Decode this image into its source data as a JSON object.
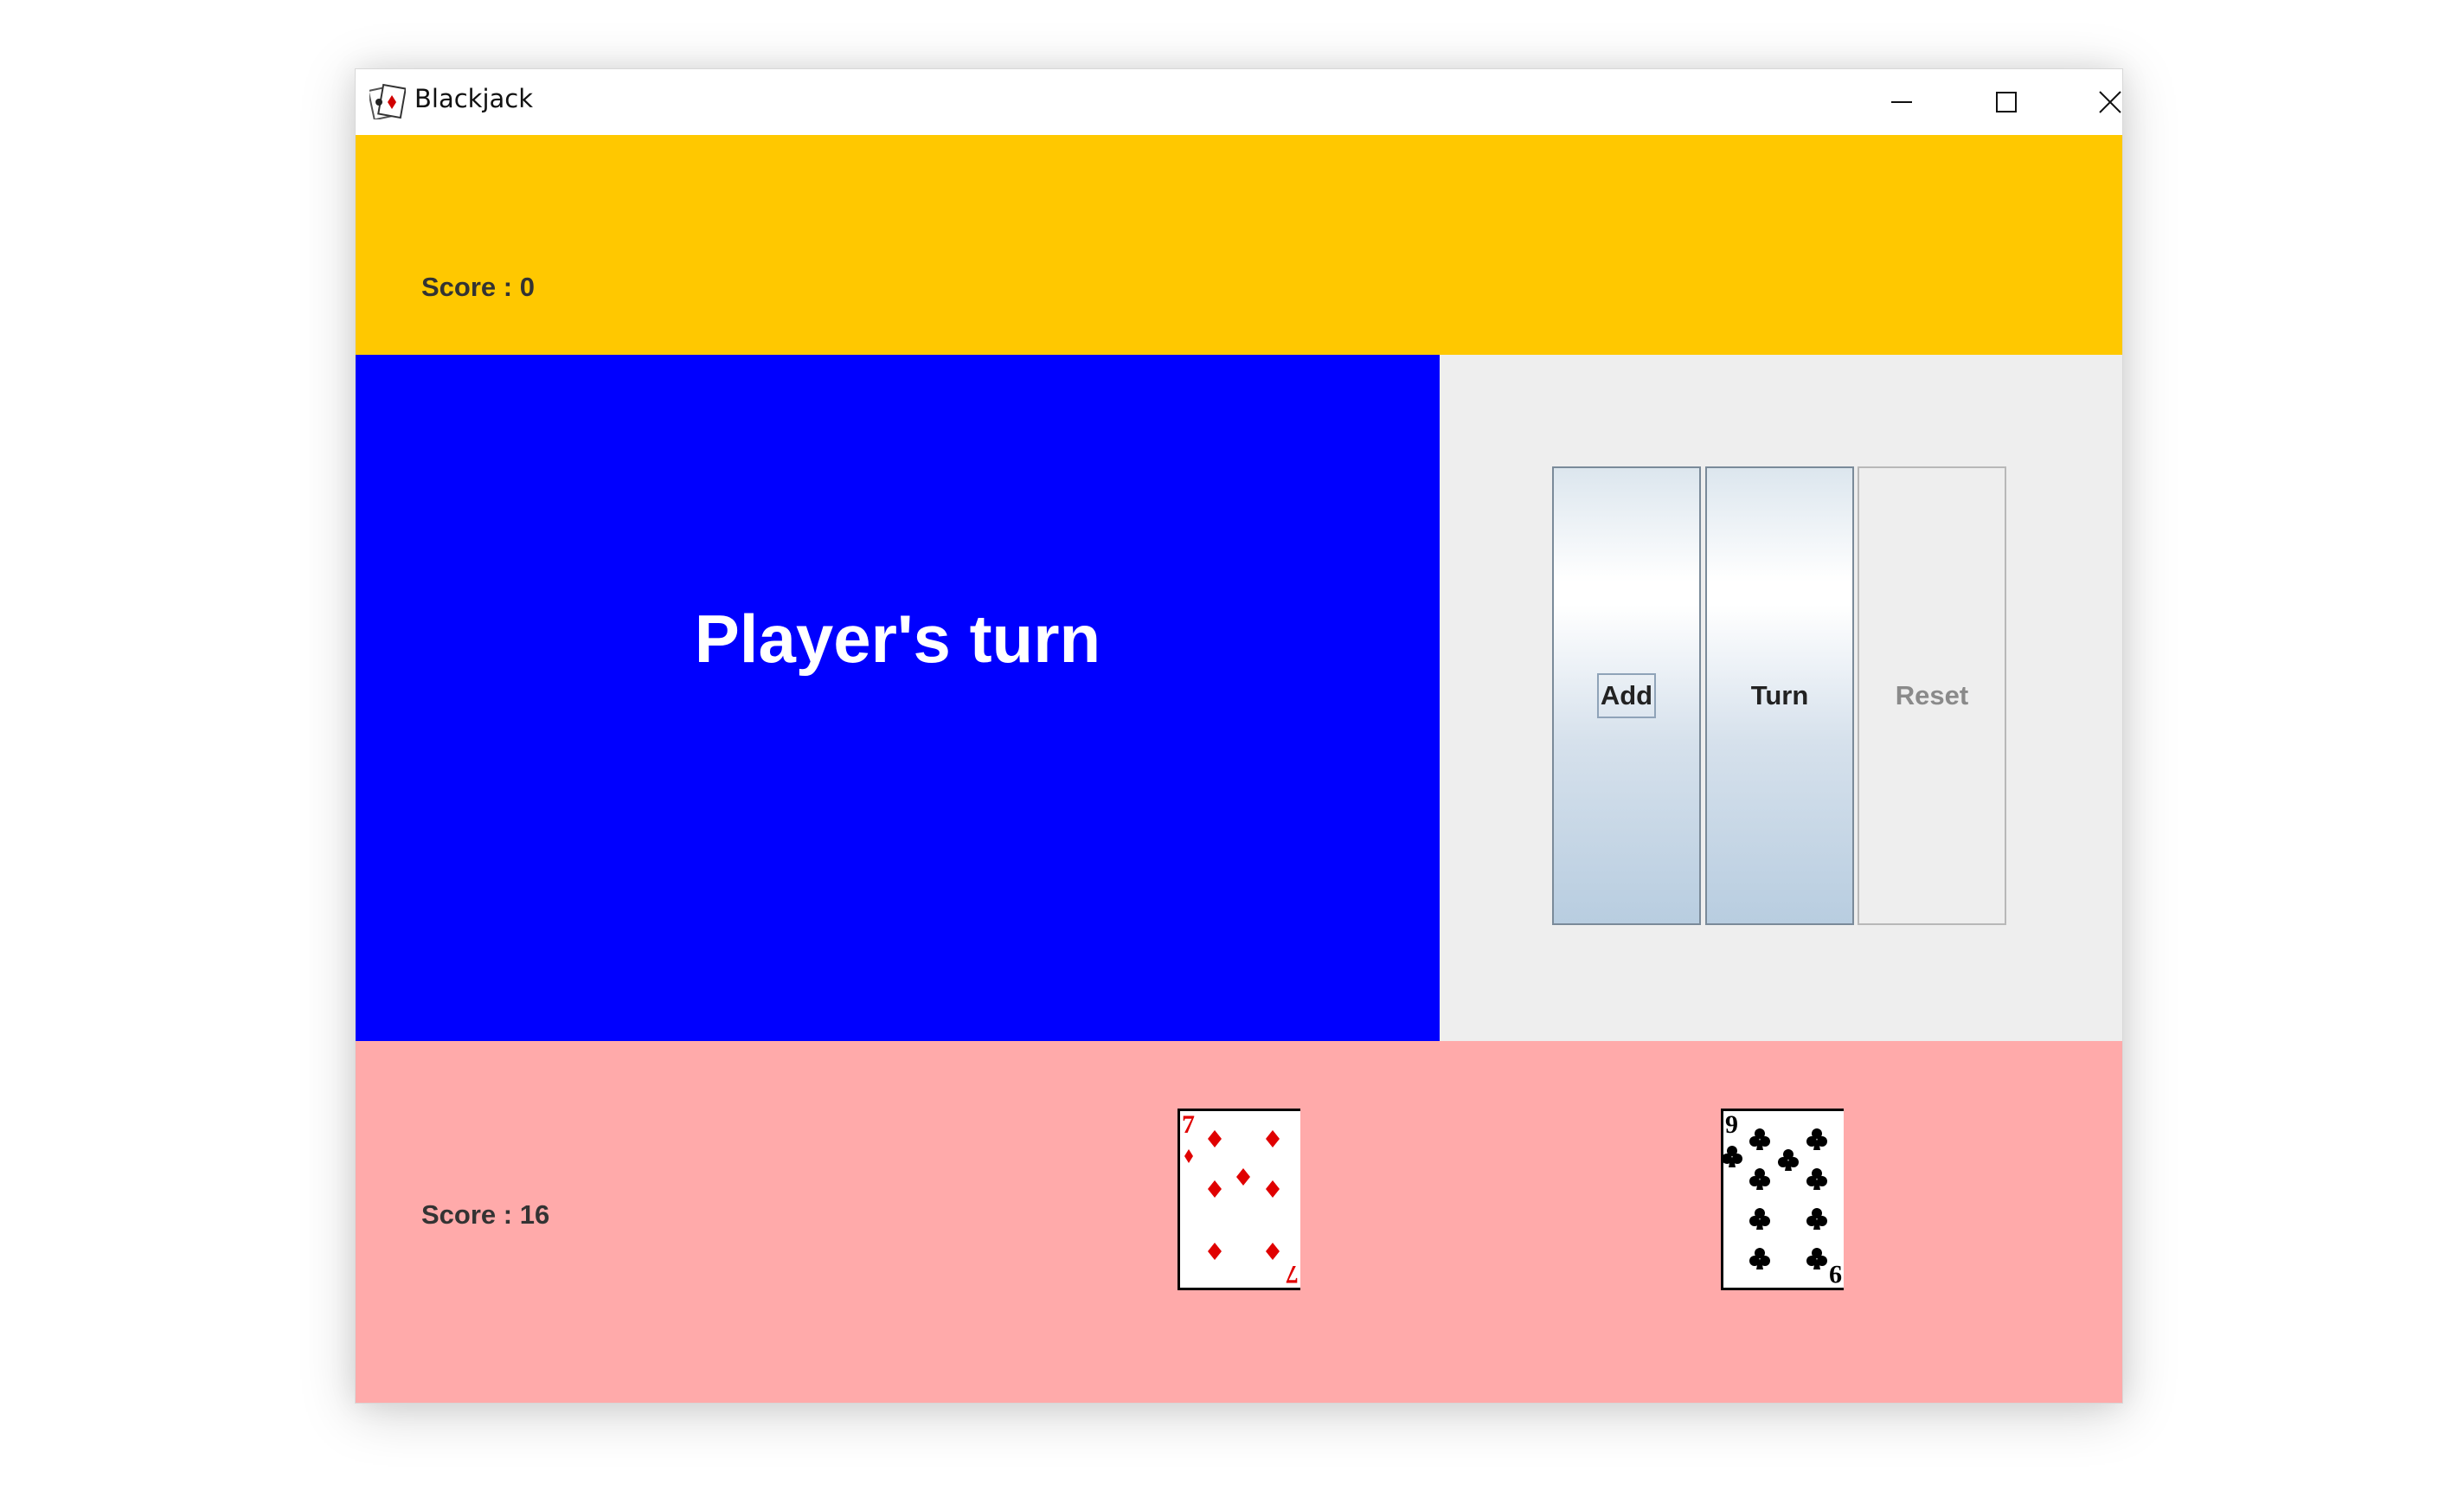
{
  "window": {
    "title": "Blackjack",
    "app_icon": "cards-icon",
    "controls": {
      "minimize_icon": "minimize-icon",
      "maximize_icon": "maximize-icon",
      "close_icon": "close-icon"
    }
  },
  "dealer": {
    "score_label": "Score : 0",
    "panel_color": "#ffc800"
  },
  "status": {
    "text": "Player's turn",
    "panel_color": "#0000ff",
    "text_color": "#ffffff"
  },
  "controls": {
    "add_label": "Add",
    "turn_label": "Turn",
    "reset_label": "Reset",
    "reset_enabled": false
  },
  "player": {
    "score_label": "Score : 16",
    "panel_color": "#ffaaaa",
    "cards": [
      {
        "rank": "7",
        "suit": "diamonds",
        "color": "#e00000"
      },
      {
        "rank": "9",
        "suit": "clubs",
        "color": "#000000"
      }
    ]
  }
}
